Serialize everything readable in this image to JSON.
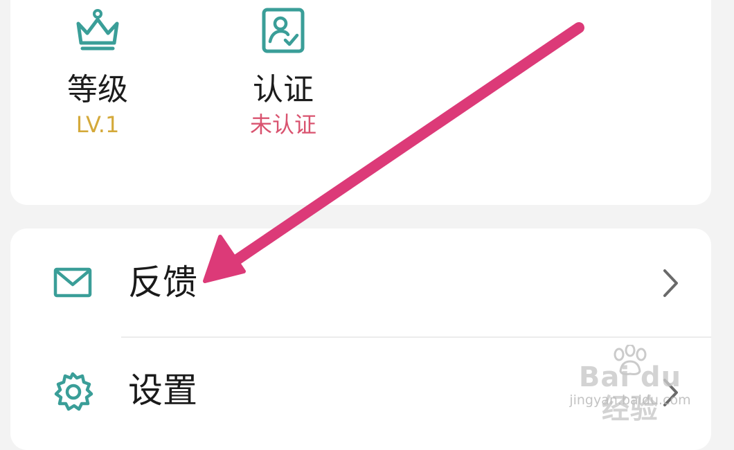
{
  "stats": [
    {
      "label": "等级",
      "value": "LV.1",
      "icon": "crown-icon",
      "value_color": "#d4a93a"
    },
    {
      "label": "认证",
      "value": "未认证",
      "icon": "verified-id-icon",
      "value_color": "#d9536f"
    }
  ],
  "menu": [
    {
      "label": "反馈",
      "icon": "mail-icon"
    },
    {
      "label": "设置",
      "icon": "gear-icon"
    }
  ],
  "colors": {
    "icon_teal": "#3a9e98",
    "arrow": "#dc3a78",
    "background": "#f3f3f3",
    "card": "#ffffff"
  },
  "watermark": {
    "brand": "Bai du 经验",
    "url": "jingyan.baidu.com"
  }
}
